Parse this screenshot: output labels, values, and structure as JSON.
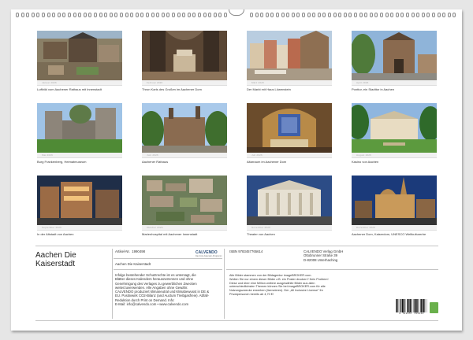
{
  "colors": {
    "background": "#e6e6e6",
    "sheet": "#ffffff",
    "rule": "#c4c4c4",
    "brand": "#2a4d7a",
    "leaf": "#6ab04c"
  },
  "photos": [
    {
      "caption": "Luftbild vom Aachener Rathaus mit Innenstadt",
      "month": "Januar 2026",
      "icon": "aerial-town-hall-photo"
    },
    {
      "caption": "Thron Karls des Großen im Aachener Dom",
      "month": "Februar 2026",
      "icon": "throne-photo"
    },
    {
      "caption": "Der Markt mit Haus Löwenstein",
      "month": "März 2026",
      "icon": "market-square-photo"
    },
    {
      "caption": "Ponttor, ein Stadttor in Aachen",
      "month": "April 2026",
      "icon": "city-gate-photo"
    },
    {
      "caption": "Burg Frankenberg, Heimatmuseum",
      "month": "Mai 2026",
      "icon": "castle-photo"
    },
    {
      "caption": "Aachener Rathaus",
      "month": "Juni 2026",
      "icon": "town-hall-photo"
    },
    {
      "caption": "Altarraum im Aachener Dom",
      "month": "Juli 2026",
      "icon": "cathedral-interior-photo"
    },
    {
      "caption": "Kasino von Aachen",
      "month": "August 2026",
      "icon": "casino-photo"
    },
    {
      "caption": "In der Altstadt von Aachen",
      "month": "September 2026",
      "icon": "old-town-night-photo"
    },
    {
      "caption": "Marienhospital mit Aachener Innenstadt",
      "month": "Oktober 2026",
      "icon": "aerial-hospital-photo"
    },
    {
      "caption": "Theater von Aachen",
      "month": "November 2026",
      "icon": "theatre-photo"
    },
    {
      "caption": "Aachener Dom, Kaiserdom, UNESCO Weltkulturerbe",
      "month": "Dezember 2026",
      "icon": "cathedral-night-photo"
    }
  ],
  "title": {
    "line1": "Aachen Die",
    "line2": "Kaiserstadt"
  },
  "article": {
    "label": "Artikel-Nr.",
    "value": "1990498",
    "name": "Aachen Die Kaiserstadt"
  },
  "isbn": "ISBN 9783457765614",
  "logo": {
    "text": "CALVENDO",
    "sub": "Das Foto-Kalender-Programm"
  },
  "publisher": [
    "CALVENDO Verlag GmbH",
    "Ottobrunner Straße 39",
    "D-82008 Unterhaching"
  ],
  "notice_left": [
    "Infolge bestehender Schutzrechte ist es untersagt, die",
    "Blätter dieses Kalenders herauszutrennen und ohne",
    "Genehmigung des Verlages zu gewerblichen Zwecken",
    "weiterzuverwenden. Alle Angaben ohne Gewähr.",
    "CALVENDO produziert klimaneutral und klimabewusst in DE &",
    "EU. Positivwirk CO2-Bilanz (and Auctum Treibgasfreie). Abfall-",
    "Reduktion durch Print on Demand. Info:",
    "E-Mail: info@calvendo.com • www.calvendo.com"
  ],
  "notice_right": [
    "Alle Bilder stammen von der Bildagentur imageBROKER.com.",
    "Wollen Sie nur einem dieser Bilder z.B. ein Poster drucken? Kein Problem!",
    "Diese und über eine Million weitere ausgewählte Bilder aus allen",
    "unterschiedlichsten Themen können Sie bei imageBROKER.com für alle",
    "Nutzungszwecke erwerben (lizenzieren). Der „All Inclusive License\" Ihr",
    "Privatpersonen bereits ab 4,70 €!"
  ],
  "barcode": {
    "number": "9 783457 765614"
  }
}
